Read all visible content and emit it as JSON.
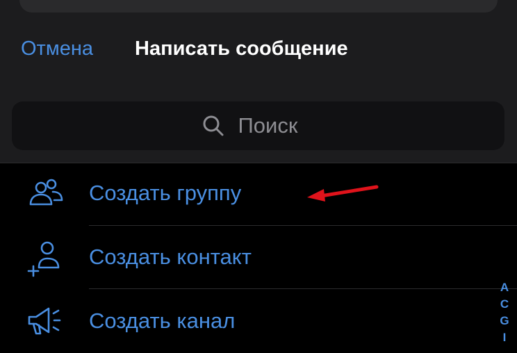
{
  "header": {
    "cancel_label": "Отмена",
    "title": "Написать сообщение"
  },
  "search": {
    "placeholder": "Поиск",
    "icon": "search-icon"
  },
  "actions": [
    {
      "label": "Создать группу",
      "icon": "group-icon"
    },
    {
      "label": "Создать контакт",
      "icon": "add-contact-icon"
    },
    {
      "label": "Создать канал",
      "icon": "megaphone-icon"
    }
  ],
  "alphabet_index": [
    "A",
    "C",
    "G",
    "I"
  ],
  "annotation": {
    "icon": "red-arrow-icon",
    "color": "#e0131b"
  },
  "colors": {
    "accent": "#4a8fe2",
    "header_bg": "#1c1c1e",
    "search_bg": "#111113",
    "list_bg": "#000000",
    "title_text": "#ffffff",
    "placeholder_text": "#8e8e93"
  }
}
